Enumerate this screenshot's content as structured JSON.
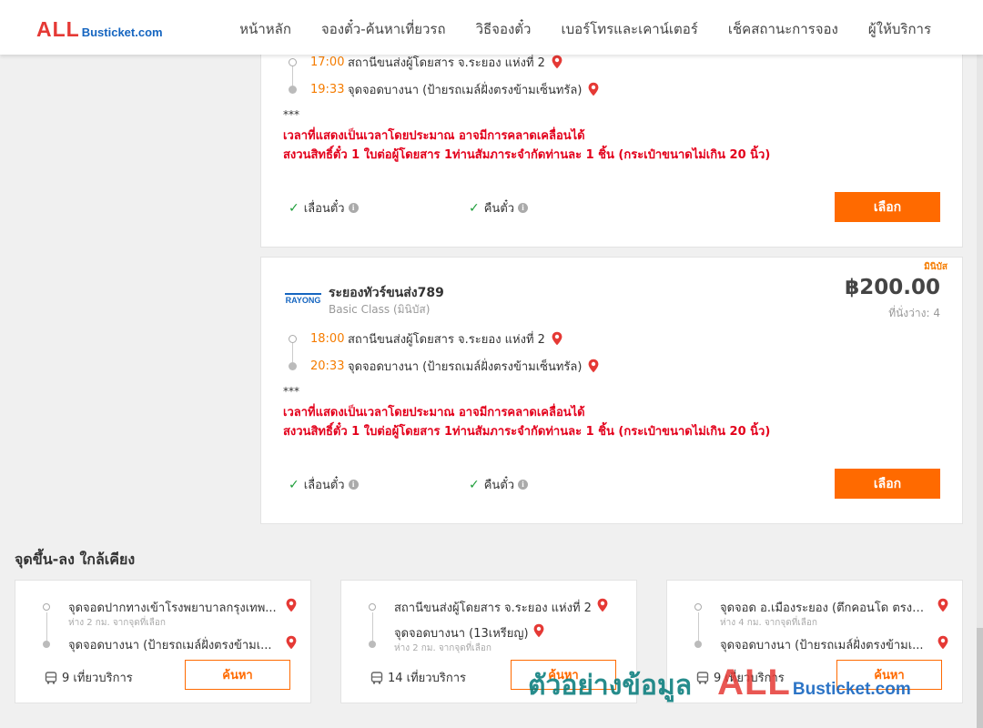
{
  "header": {
    "logo_all": "ALL",
    "logo_rest": "Busticket.com",
    "nav": [
      "หน้าหลัก",
      "จองตั๋ว-ค้นหาเที่ยวรถ",
      "วิธีจองตั๋ว",
      "เบอร์โทรและเคาน์เตอร์",
      "เช็คสถานะการจอง",
      "ผู้ให้บริการ"
    ]
  },
  "trip1": {
    "depart_time": "17:00",
    "depart_place": "สถานีขนส่งผู้โดยสาร จ.ระยอง แห่งที่ 2",
    "arrive_time": "19:33",
    "arrive_place": "จุดจอดบางนา (ป้ายรถเมล์ฝั่งตรงข้ามเซ็นทรัล)",
    "stars": "***",
    "notice1": "เวลาที่แสดงเป็นเวลาโดยประมาณ อาจมีการคลาดเคลื่อนได้",
    "notice2": "สงวนสิทธิ์ตั๋ว 1 ใบต่อผู้โดยสาร 1ท่านสัมภาระจำกัดท่านละ 1 ชิ้น (กระเป๋าขนาดไม่เกิน 20 นิ้ว)",
    "feature1": "เลื่อนตั๋ว",
    "feature2": "คืนตั๋ว",
    "select": "เลือก"
  },
  "trip2": {
    "tag": "มินิบัส",
    "company_logo_text": "RAYONG",
    "company": "ระยองทัวร์ขนส่ง789",
    "class": "Basic Class (มินิบัส)",
    "price": "฿200.00",
    "seats": "ที่นั่งว่าง: 4",
    "depart_time": "18:00",
    "depart_place": "สถานีขนส่งผู้โดยสาร จ.ระยอง แห่งที่ 2",
    "arrive_time": "20:33",
    "arrive_place": "จุดจอดบางนา (ป้ายรถเมล์ฝั่งตรงข้ามเซ็นทรัล)",
    "stars": "***",
    "notice1": "เวลาที่แสดงเป็นเวลาโดยประมาณ อาจมีการคลาดเคลื่อนได้",
    "notice2": "สงวนสิทธิ์ตั๋ว 1 ใบต่อผู้โดยสาร 1ท่านสัมภาระจำกัดท่านละ 1 ชิ้น (กระเป๋าขนาดไม่เกิน 20 นิ้ว)",
    "feature1": "เลื่อนตั๋ว",
    "feature2": "คืนตั๋ว",
    "select": "เลือก"
  },
  "nearby": {
    "title": "จุดขึ้น-ลง ใกล้เคียง",
    "cards": [
      {
        "from": "จุดจอดปากทางเข้าโรงพยาบาลกรุงเทพ...",
        "from_dist": "ห่าง 2 กม. จากจุดที่เลือก",
        "to": "จุดจอดบางนา (ป้ายรถเมล์ฝั่งตรงข้ามเ...",
        "to_dist": "",
        "trips": "9 เที่ยวบริการ",
        "search": "ค้นหา"
      },
      {
        "from": "สถานีขนส่งผู้โดยสาร จ.ระยอง แห่งที่ 2",
        "from_dist": "",
        "to": "จุดจอดบางนา (13เหรียญ)",
        "to_dist": "ห่าง 2 กม. จากจุดที่เลือก",
        "trips": "14 เที่ยวบริการ",
        "search": "ค้นหา"
      },
      {
        "from": "จุดจอด อ.เมืองระยอง (ตึกคอนโด ตรงข้า...",
        "from_dist": "ห่าง 4 กม. จากจุดที่เลือก",
        "to": "จุดจอดบางนา (ป้ายรถเมล์ฝั่งตรงข้ามเ...",
        "to_dist": "",
        "trips": "9 เที่ยวบริการ",
        "search": "ค้นหา"
      }
    ]
  },
  "watermark": {
    "thai": "ตัวอย่างข้อมูล",
    "all": "ALL",
    "rest": "Busticket.com"
  },
  "colors": {
    "accent": "#ff6a00",
    "time": "#f57c00",
    "notice": "#e3001b",
    "check": "#1e9e3a",
    "pin": "#e53935"
  },
  "icons": [
    "map-pin-icon",
    "check-icon",
    "info-icon",
    "bus-icon"
  ]
}
